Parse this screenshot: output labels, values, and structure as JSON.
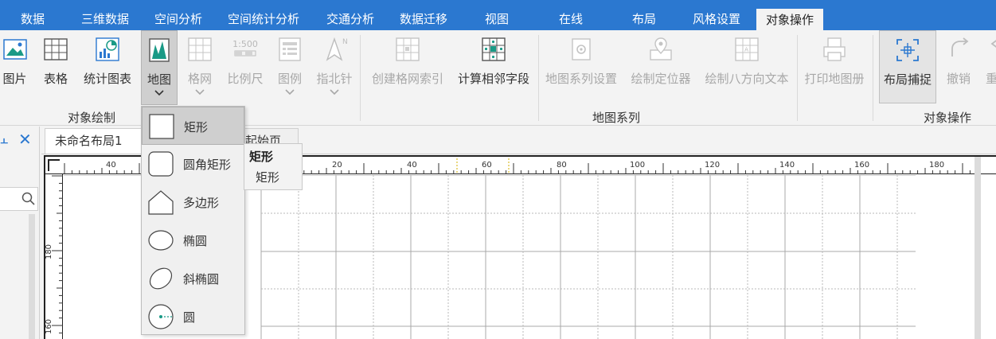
{
  "tabs": [
    "数据",
    "三维数据",
    "空间分析",
    "空间统计分析",
    "交通分析",
    "数据迁移",
    "视图",
    "在线",
    "布局",
    "风格设置",
    "对象操作"
  ],
  "active_tab": "对象操作",
  "ribbon": {
    "picture": "图片",
    "table": "表格",
    "stat_chart": "统计图表",
    "map": "地图",
    "grid": "格网",
    "scale": "比例尺",
    "legend": "图例",
    "north": "指北针",
    "create_grid_index": "创建格网索引",
    "calc_neighbor": "计算相邻字段",
    "map_series_settings": "地图系列设置",
    "draw_locator": "绘制定位器",
    "draw_eight_dir_text": "绘制八方向文本",
    "print_map_book": "打印地图册",
    "layout_snap": "布局捕捉",
    "undo": "撤销",
    "redo": "重",
    "group_object_draw": "对象绘制",
    "group_map_series": "地图系列",
    "group_object_ops": "对象操作",
    "scale_icon_text": "1:500"
  },
  "doc_tabs": {
    "active": "未命名布局1",
    "other": "起始页"
  },
  "dropdown": {
    "items": [
      "矩形",
      "圆角矩形",
      "多边形",
      "椭圆",
      "斜椭圆",
      "圆"
    ]
  },
  "tooltip": {
    "title": "矩形",
    "desc": "矩形"
  },
  "rulers": {
    "h_labels": [
      "40",
      "20",
      "40",
      "60",
      "80",
      "100",
      "120",
      "140",
      "160",
      "180"
    ],
    "v_labels": [
      "180",
      "160"
    ]
  },
  "colors": {
    "tabbar": "#2b78d0",
    "accent": "#2b78d0",
    "teal": "#1a9a86"
  }
}
